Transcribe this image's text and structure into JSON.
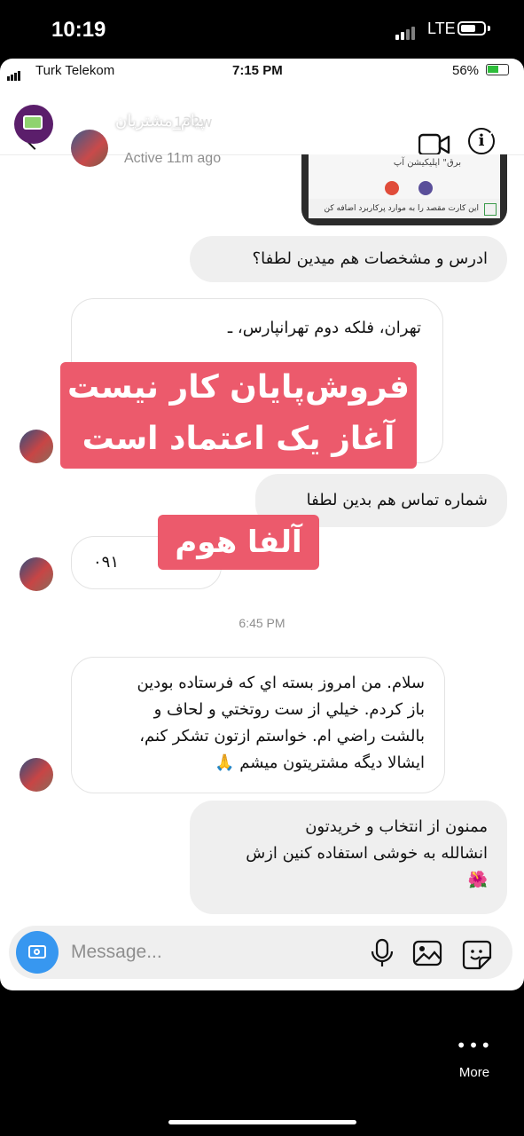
{
  "phone_status": {
    "time": "10:19",
    "network": "LTE"
  },
  "inner_status": {
    "carrier": "Turk Telekom",
    "time": "7:15 PM",
    "battery": "56%"
  },
  "story": {
    "name": "پیام_مشتریان",
    "age": "132w"
  },
  "header": {
    "active": "Active 11m ago",
    "info_label": "i"
  },
  "shared_card": {
    "top_text": "برق\" اپلیکیشن آپ",
    "bottom_text": "این کارت مقصد را به موارد پرکاربرد اضافه کن"
  },
  "messages": [
    {
      "type": "sent",
      "text": "ادرس و مشخصات هم میدین لطفا؟"
    },
    {
      "type": "received",
      "text": "تهران، فلکه دوم تهرانپارس، ـ"
    },
    {
      "type": "sent",
      "text": "شماره تماس هم بدین لطفا"
    },
    {
      "type": "received",
      "text": "۰۹۱"
    },
    {
      "type": "received",
      "lines": [
        "سلام. من امروز بسته اي كه فرستاده بودين",
        "باز كردم. خيلي از ست روتختي و لحاف و",
        "بالشت راضي ام. خواستم ازتون تشكر كنم،",
        "ايشالا ديگه مشتريتون ميشم 🙏"
      ]
    },
    {
      "type": "sent",
      "lines": [
        "ممنون از انتخاب و خریدتون",
        "انشالله به خوشی استفاده کنین ازش",
        "🌺"
      ]
    }
  ],
  "timestamp": "6:45 PM",
  "overlay": {
    "line1": "فروش‌پایان کار نیست",
    "line2": "آغاز یک اعتماد است",
    "brand": "آلفا هوم"
  },
  "composer": {
    "placeholder": "Message..."
  },
  "more_label": "More",
  "colors": {
    "overlay": "#ec5a6c",
    "camera": "#3797f0",
    "sent_bubble": "#efefef"
  }
}
